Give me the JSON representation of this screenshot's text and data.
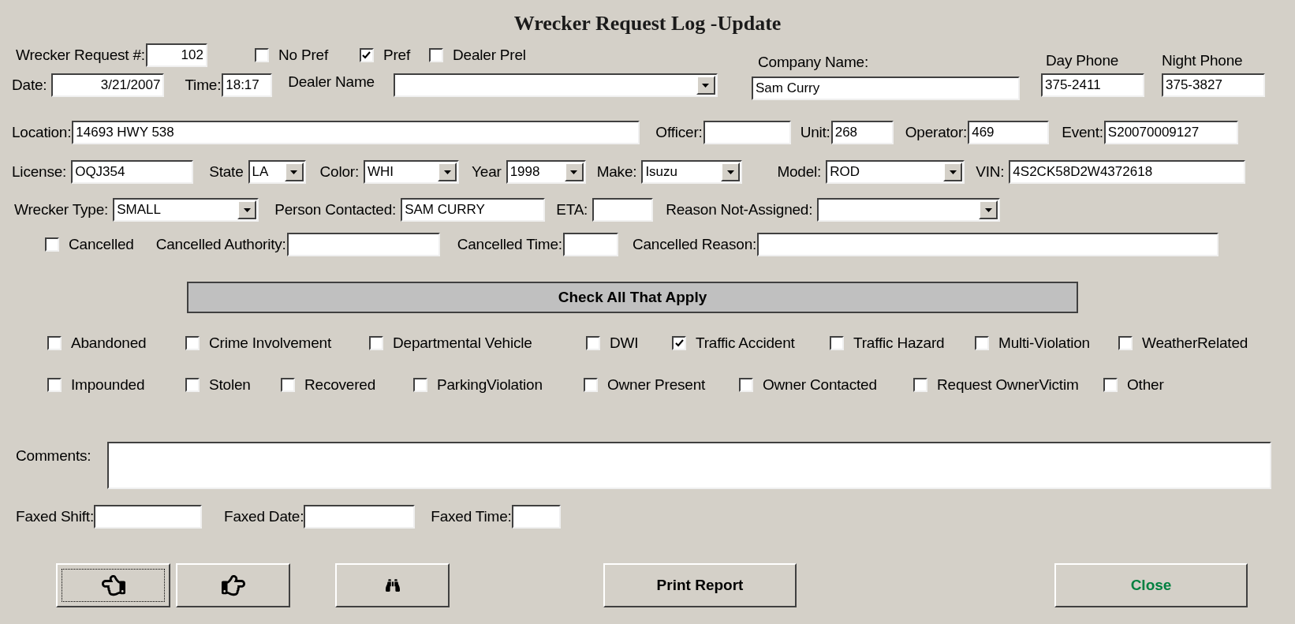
{
  "title": "Wrecker Request Log -Update",
  "request": {
    "label": "Wrecker Request #:",
    "value": "102"
  },
  "preferences": [
    {
      "label": "No Pref",
      "checked": false
    },
    {
      "label": "Pref",
      "checked": true
    },
    {
      "label": "Dealer Prel",
      "checked": false
    }
  ],
  "date": {
    "label": "Date:",
    "value": "3/21/2007"
  },
  "time": {
    "label": "Time:",
    "value": "18:17"
  },
  "dealer": {
    "label": "Dealer Name"
  },
  "company": {
    "label": "Company Name:",
    "value": "Sam Curry"
  },
  "day_phone": {
    "label": "Day Phone",
    "value": "375-2411"
  },
  "night_phone": {
    "label": "Night Phone",
    "value": "375-3827"
  },
  "rows": [
    [
      {
        "kind": "field",
        "label": "Location:",
        "value": "14693 HWY 538"
      },
      {
        "kind": "field",
        "label": "Officer:"
      },
      {
        "kind": "field",
        "label": "Unit:",
        "value": "268"
      },
      {
        "kind": "field",
        "label": "Operator:",
        "value": "469"
      },
      {
        "kind": "field",
        "label": "Event:",
        "value": "S20070009127"
      }
    ],
    [
      {
        "kind": "field",
        "label": "License:",
        "value": "OQJ354"
      },
      {
        "kind": "dropdown",
        "label": "State",
        "value": "LA"
      },
      {
        "kind": "dropdown",
        "label": "Color:",
        "value": "WHI"
      },
      {
        "kind": "dropdown",
        "label": "Year",
        "value": "1998"
      },
      {
        "kind": "dropdown",
        "label": "Make:",
        "value": "Isuzu"
      },
      {
        "kind": "dropdown",
        "label": "Model:",
        "value": "ROD"
      },
      {
        "kind": "field",
        "label": "VIN:",
        "value": "4S2CK58D2W4372618"
      }
    ],
    [
      {
        "kind": "dropdown",
        "label": "Wrecker Type:",
        "value": "SMALL"
      },
      {
        "kind": "field",
        "label": "Person Contacted:",
        "value": "SAM CURRY"
      },
      {
        "kind": "field",
        "label": "ETA:"
      },
      {
        "kind": "dropdown",
        "label": "Reason Not-Assigned:"
      }
    ],
    [
      {
        "kind": "checkbox",
        "label": "Cancelled",
        "checked": false
      },
      {
        "kind": "field",
        "label": "Cancelled Authority:"
      },
      {
        "kind": "field",
        "label": "Cancelled Time:"
      },
      {
        "kind": "field",
        "label": "Cancelled Reason:"
      }
    ]
  ],
  "banner": "Check All That Apply",
  "checks": [
    [
      {
        "label": "Abandoned",
        "checked": false
      },
      {
        "label": "Crime Involvement",
        "checked": false
      },
      {
        "label": "Departmental Vehicle",
        "checked": false
      },
      {
        "label": "DWI",
        "checked": false
      },
      {
        "label": "Traffic Accident",
        "checked": true
      },
      {
        "label": "Traffic Hazard",
        "checked": false
      },
      {
        "label": "Multi-Violation",
        "checked": false
      },
      {
        "label": "WeatherRelated",
        "checked": false
      }
    ],
    [
      {
        "label": "Impounded",
        "checked": false
      },
      {
        "label": "Stolen",
        "checked": false
      },
      {
        "label": "Recovered",
        "checked": false
      },
      {
        "label": "ParkingViolation",
        "checked": false
      },
      {
        "label": "Owner Present",
        "checked": false
      },
      {
        "label": "Owner Contacted",
        "checked": false
      },
      {
        "label": "Request OwnerVictim",
        "checked": false
      },
      {
        "label": "Other",
        "checked": false
      }
    ]
  ],
  "comments": {
    "label": "Comments:"
  },
  "faxed": [
    {
      "label": "Faxed Shift:"
    },
    {
      "label": "Faxed Date:"
    },
    {
      "label": "Faxed Time:"
    }
  ],
  "buttons": [
    {
      "kind": "previous"
    },
    {
      "kind": "next"
    },
    {
      "kind": "find"
    },
    {
      "kind": "text",
      "label": "Print Report"
    },
    {
      "kind": "close",
      "label": "Close"
    }
  ]
}
